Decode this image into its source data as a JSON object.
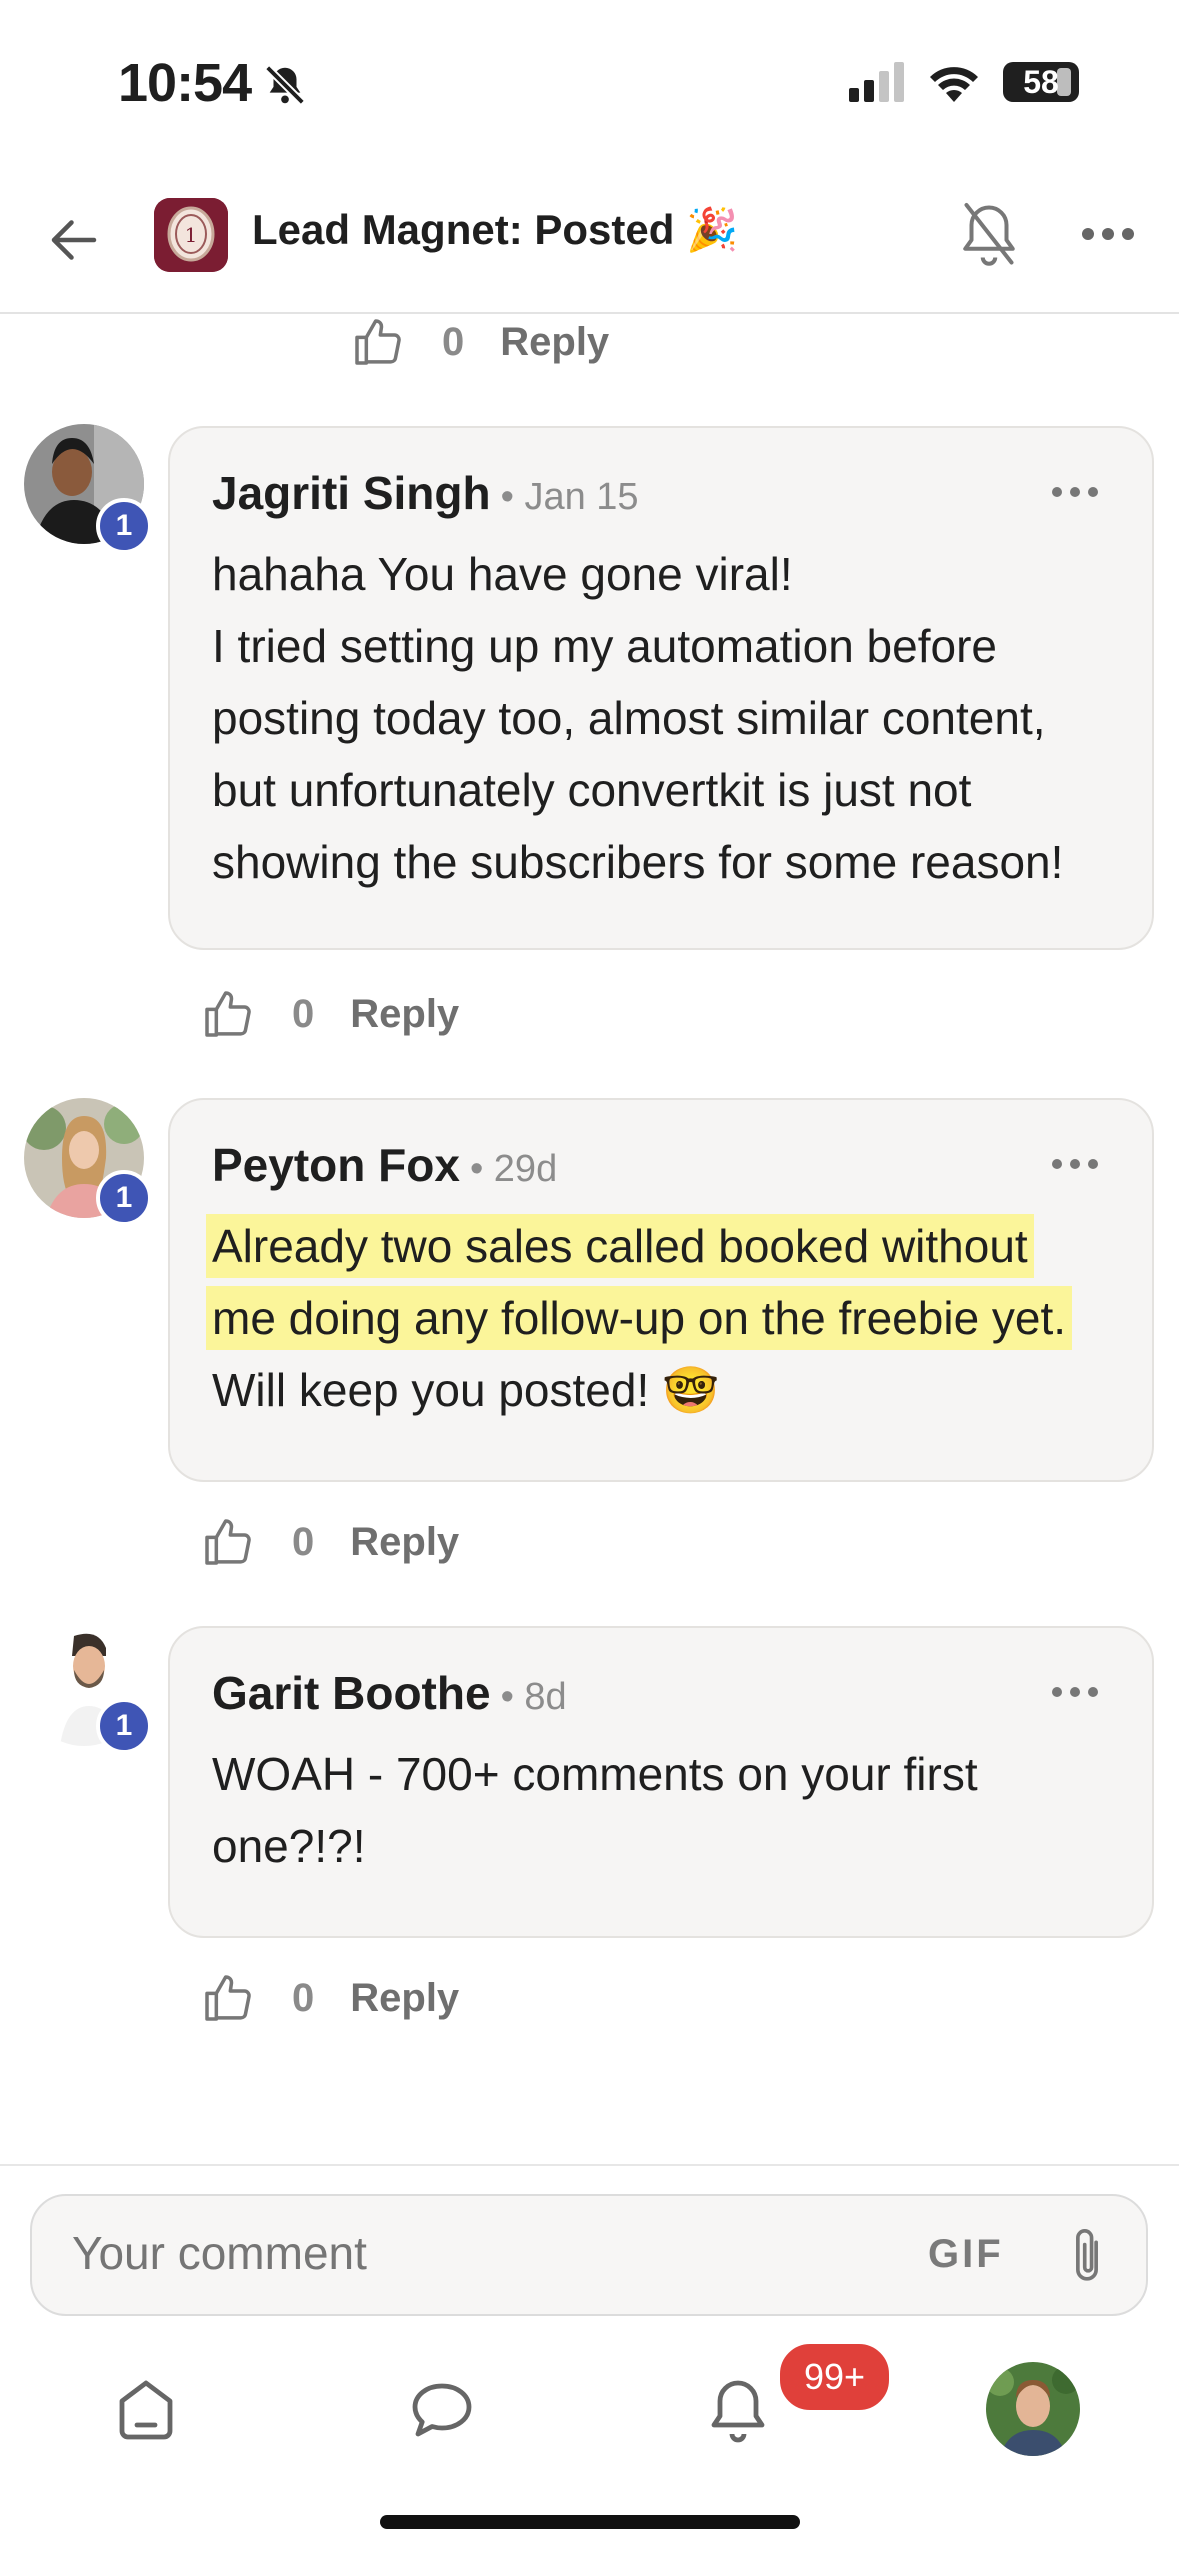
{
  "status_bar": {
    "time": "10:54",
    "battery": "58"
  },
  "header": {
    "title": "Lead Magnet: Posted 🎉"
  },
  "top_actions": {
    "likes": "0",
    "reply_label": "Reply"
  },
  "comments": [
    {
      "author": "Jagriti Singh",
      "meta": "• Jan 15",
      "badge": "1",
      "lines": [
        "hahaha You have gone viral!",
        "I tried setting up my automation before",
        "posting today too, almost similar content,",
        "but unfortunately convertkit is just not",
        "showing the subscribers for some reason!"
      ],
      "likes": "0",
      "reply_label": "Reply"
    },
    {
      "author": "Peyton Fox",
      "meta": "• 29d",
      "badge": "1",
      "lines": [
        "Already two sales called booked without",
        "me doing any follow-up on the freebie yet.",
        "Will keep you posted! 🤓"
      ],
      "likes": "0",
      "reply_label": "Reply"
    },
    {
      "author": "Garit Boothe",
      "meta": "• 8d",
      "badge": "1",
      "lines": [
        "WOAH - 700+ comments on your first",
        "one?!?!"
      ],
      "likes": "0",
      "reply_label": "Reply"
    }
  ],
  "composer": {
    "placeholder": "Your comment",
    "gif_label": "GIF"
  },
  "tab_bar": {
    "notifications_badge": "99+"
  },
  "colors": {
    "badge_blue": "#3f55b5",
    "highlight": "#fbf59a",
    "notif_red": "#e0403a"
  },
  "icons": [
    "bell-off-icon",
    "back-arrow-icon",
    "more-icon",
    "thumbs-up-icon",
    "paperclip-icon",
    "home-icon",
    "chat-icon",
    "bell-icon"
  ]
}
